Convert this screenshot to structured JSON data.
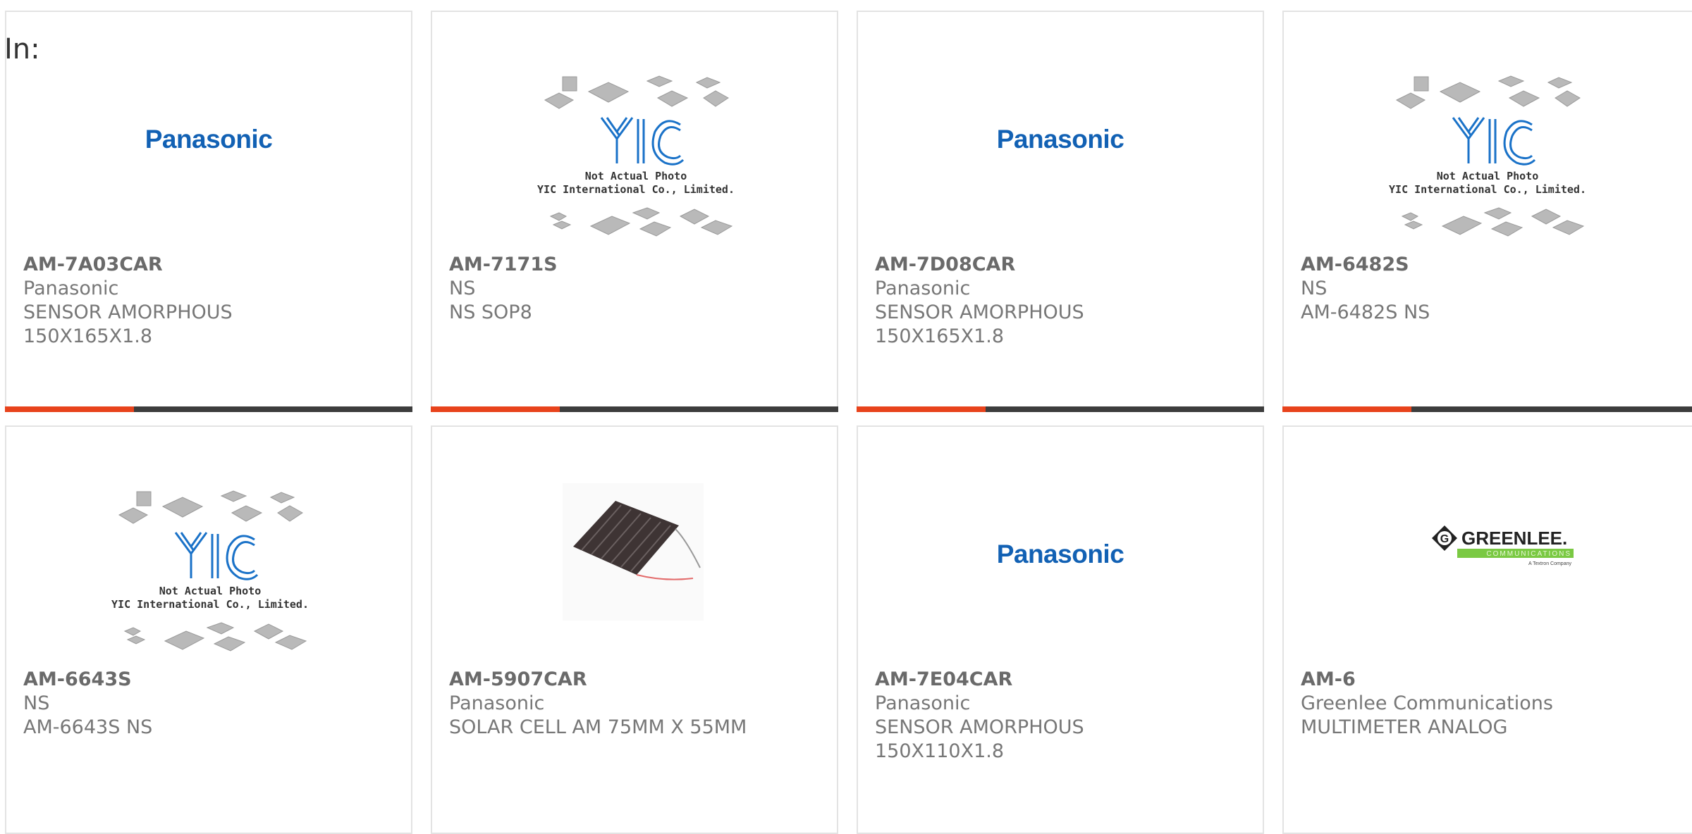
{
  "page": {
    "in_label": "In:"
  },
  "placeholders": {
    "yic_line1": "Not Actual Photo",
    "yic_line2": "YIC International Co., Limited."
  },
  "logos": {
    "panasonic": "Panasonic",
    "greenlee": "GREENLEE.",
    "greenlee_sub": "COMMUNICATIONS",
    "greenlee_tag": "A Textron Company"
  },
  "colors": {
    "panasonic_blue": "#1261b4",
    "accent_orange": "#e8431c",
    "bar_dark": "#3d3d3d",
    "greenlee_green": "#7ac943"
  },
  "products": [
    {
      "part": "AM-7A03CAR",
      "maker": "Panasonic",
      "desc1": "SENSOR AMORPHOUS",
      "desc2": "150X165X1.8",
      "image": "panasonic-logo"
    },
    {
      "part": "AM-7171S",
      "maker": "NS",
      "desc1": "NS SOP8",
      "desc2": "",
      "image": "yic-placeholder"
    },
    {
      "part": "AM-7D08CAR",
      "maker": "Panasonic",
      "desc1": "SENSOR AMORPHOUS",
      "desc2": "150X165X1.8",
      "image": "panasonic-logo"
    },
    {
      "part": "AM-6482S",
      "maker": "NS",
      "desc1": "AM-6482S NS",
      "desc2": "",
      "image": "yic-placeholder"
    },
    {
      "part": "AM-6643S",
      "maker": "NS",
      "desc1": "AM-6643S NS",
      "desc2": "",
      "image": "yic-placeholder"
    },
    {
      "part": "AM-5907CAR",
      "maker": "Panasonic",
      "desc1": "SOLAR CELL AM 75MM X 55MM",
      "desc2": "",
      "image": "solar-cell-photo"
    },
    {
      "part": "AM-7E04CAR",
      "maker": "Panasonic",
      "desc1": "SENSOR AMORPHOUS",
      "desc2": "150X110X1.8",
      "image": "panasonic-logo"
    },
    {
      "part": "AM-6",
      "maker": "Greenlee Communications",
      "desc1": "MULTIMETER ANALOG",
      "desc2": "",
      "image": "greenlee-logo"
    }
  ]
}
